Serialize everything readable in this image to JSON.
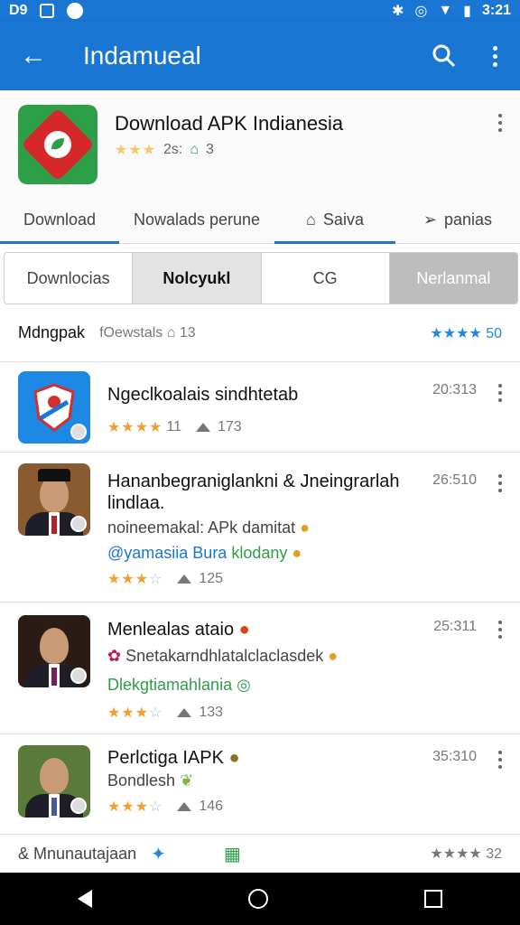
{
  "status": {
    "left1": "D9",
    "time": "3:21"
  },
  "appbar": {
    "title": "Indamueal"
  },
  "header": {
    "app_title": "Download APK Indianesia",
    "rating_text": "2s:",
    "count": "3",
    "tabs": [
      {
        "label": "Download"
      },
      {
        "label": "Nowalads perune"
      },
      {
        "label": "Saiva"
      },
      {
        "label": "panias"
      }
    ]
  },
  "segments": [
    "Downlocias",
    "Nolcyukl",
    "CG",
    "Nerlanmal"
  ],
  "filter": {
    "label": "Mdngpak",
    "sub": "fOewstals",
    "sub_count": "13",
    "rating_count": "50"
  },
  "items": [
    {
      "title": "Ngeclkoalais sindhtetab",
      "time": "20:313",
      "count": "173",
      "stars": "★★★★",
      "rating": "11"
    },
    {
      "title": "Hananbegraniglankni & Jneingrarlah lindlaa.",
      "line2": "noineemakal: APk damitat",
      "line3": "@yamasiia Bura",
      "line3_green": "klodany",
      "time": "26:510",
      "count": "125"
    },
    {
      "title": "Menlealas ataio",
      "line2": "Snetakarndhlatalclaclasdek",
      "line3": "Dlekgtiamahlania",
      "time": "25:311",
      "count": "133"
    },
    {
      "title": "Perlctiga IAPK",
      "line2": "Bondlesh",
      "time": "35:310",
      "count": "146"
    }
  ],
  "bottom": {
    "text": "& Mnunautajaan",
    "count": "32"
  }
}
